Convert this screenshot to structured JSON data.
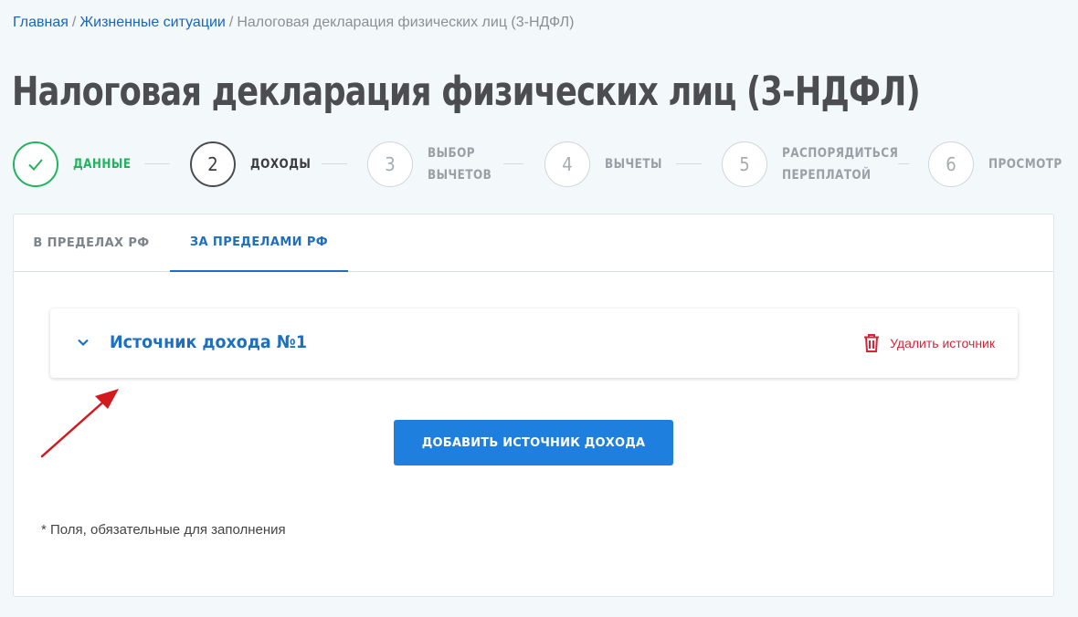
{
  "breadcrumb": {
    "home": "Главная",
    "section": "Жизненные ситуации",
    "separator": "/",
    "current": "Налоговая декларация физических лиц (3-НДФЛ)"
  },
  "page": {
    "title": "Налоговая декларация физических лиц (3-НДФЛ)"
  },
  "stepper": {
    "steps": [
      {
        "number": "✓",
        "label_line1": "ДАННЫЕ",
        "label_line2": "",
        "state": "done"
      },
      {
        "number": "2",
        "label_line1": "ДОХОДЫ",
        "label_line2": "",
        "state": "active"
      },
      {
        "number": "3",
        "label_line1": "ВЫБОР",
        "label_line2": "ВЫЧЕТОВ",
        "state": "pending"
      },
      {
        "number": "4",
        "label_line1": "ВЫЧЕТЫ",
        "label_line2": "",
        "state": "pending"
      },
      {
        "number": "5",
        "label_line1": "РАСПОРЯДИТЬСЯ",
        "label_line2": "ПЕРЕПЛАТОЙ",
        "state": "pending"
      },
      {
        "number": "6",
        "label_line1": "ПРОСМОТР",
        "label_line2": "",
        "state": "pending"
      }
    ]
  },
  "tabs": [
    {
      "label": "В ПРЕДЕЛАХ РФ",
      "active": false
    },
    {
      "label": "ЗА ПРЕДЕЛАМИ РФ",
      "active": true
    }
  ],
  "income_source": {
    "title": "Источник дохода №1",
    "delete_label": "Удалить источник",
    "icons": {
      "toggle": "chevron-down-icon",
      "delete": "trash-icon"
    }
  },
  "actions": {
    "add_source_label": "ДОБАВИТЬ ИСТОЧНИК ДОХОДА"
  },
  "footer_note": "* Поля, обязательные для заполнения",
  "colors": {
    "primary": "#1e7fde",
    "link": "#1a66b8",
    "success": "#22b35e",
    "danger": "#d42639",
    "annotation_arrow": "#d3191c"
  }
}
